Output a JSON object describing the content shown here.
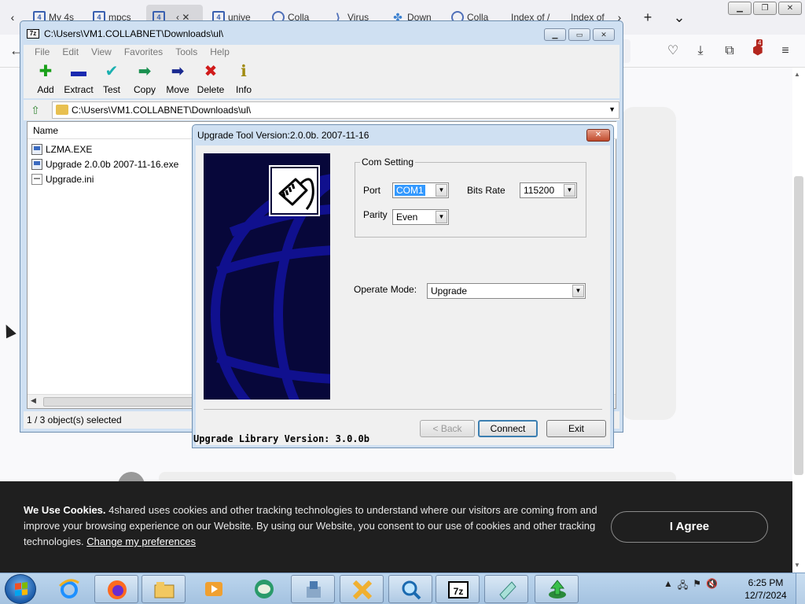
{
  "browser": {
    "tabs": [
      {
        "label": "My 4s",
        "icon": "fourshared-icon"
      },
      {
        "label": "mpcs",
        "icon": "fourshared-icon"
      },
      {
        "label": "",
        "icon": "fourshared-icon",
        "active": true
      },
      {
        "label": "unive",
        "icon": "fourshared-icon"
      },
      {
        "label": "Colla",
        "icon": "search-icon"
      },
      {
        "label": "Virus",
        "icon": "code-icon"
      },
      {
        "label": "Down",
        "icon": "paw-icon"
      },
      {
        "label": "Colla",
        "icon": "search-icon"
      },
      {
        "label": "Index of /",
        "icon": ""
      },
      {
        "label": "Index of",
        "icon": ""
      }
    ],
    "new_tab": "+",
    "tab_list": "⌄",
    "extension_badge": "4"
  },
  "zip": {
    "title": "C:\\Users\\VM1.COLLABNET\\Downloads\\ul\\",
    "menu": [
      "File",
      "Edit",
      "View",
      "Favorites",
      "Tools",
      "Help"
    ],
    "toolbar": [
      {
        "label": "Add",
        "icon": "add-icon",
        "glyph": "✚",
        "color": "#1aa01a"
      },
      {
        "label": "Extract",
        "icon": "extract-icon",
        "glyph": "▬",
        "color": "#1a2ab0"
      },
      {
        "label": "Test",
        "icon": "test-icon",
        "glyph": "✔",
        "color": "#1ab0b0"
      },
      {
        "label": "Copy",
        "icon": "copy-icon",
        "glyph": "➡",
        "color": "#1a9050"
      },
      {
        "label": "Move",
        "icon": "move-icon",
        "glyph": "➡",
        "color": "#1a2a90"
      },
      {
        "label": "Delete",
        "icon": "delete-icon",
        "glyph": "✖",
        "color": "#d01a1a"
      },
      {
        "label": "Info",
        "icon": "info-icon",
        "glyph": "ℹ",
        "color": "#a08a10"
      }
    ],
    "path": "C:\\Users\\VM1.COLLABNET\\Downloads\\ul\\",
    "columns": {
      "name": "Name"
    },
    "files": [
      {
        "name": "LZMA.EXE",
        "icon": "exe-file-icon"
      },
      {
        "name": "Upgrade 2.0.0b 2007-11-16.exe",
        "icon": "exe-file-icon"
      },
      {
        "name": "Upgrade.ini",
        "icon": "ini-file-icon"
      }
    ],
    "status": "1 / 3 object(s) selected"
  },
  "upgrade": {
    "title": "Upgrade Tool Version:2.0.0b. 2007-11-16",
    "com_setting": "Com Setting",
    "port_label": "Port",
    "port_value": "COM1",
    "bits_rate_label": "Bits Rate",
    "bits_rate_value": "115200",
    "parity_label": "Parity",
    "parity_value": "Even",
    "operate_mode_label": "Operate Mode:",
    "operate_mode_value": "Upgrade",
    "back_label": "< Back",
    "connect_label": "Connect",
    "exit_label": "Exit",
    "library_version": "Upgrade Library Version: 3.0.0b"
  },
  "cookie": {
    "heading": "We Use Cookies.",
    "body": "4shared uses cookies and other tracking technologies to understand where our visitors are coming from and improve your browsing experience on our Website. By using our Website, you consent to our use of cookies and other tracking technologies.",
    "link": "Change my preferences",
    "agree": "I Agree"
  },
  "taskbar": {
    "apps": [
      {
        "name": "ie-icon"
      },
      {
        "name": "firefox-icon"
      },
      {
        "name": "explorer-icon"
      },
      {
        "name": "media-player-icon"
      },
      {
        "name": "teamviewer-icon"
      },
      {
        "name": "installer-icon"
      },
      {
        "name": "tools-icon"
      },
      {
        "name": "search-tool-icon"
      },
      {
        "name": "7zip-icon"
      },
      {
        "name": "device-icon"
      },
      {
        "name": "upgrade-tool-icon"
      }
    ],
    "time": "6:25 PM",
    "date": "12/7/2024"
  }
}
